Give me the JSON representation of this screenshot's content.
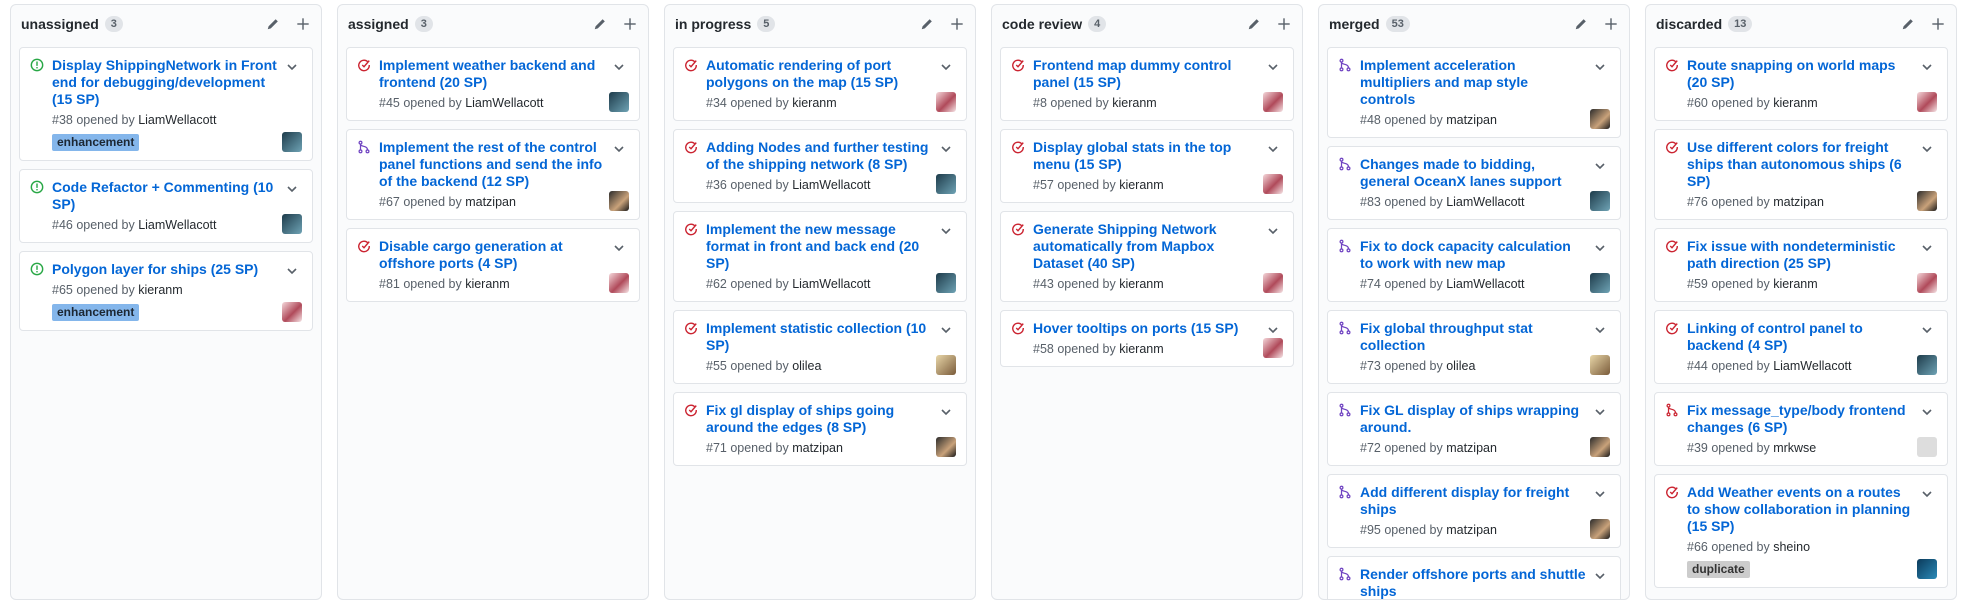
{
  "colors": {
    "open_issue": "#28a745",
    "closed_issue": "#cb2431",
    "merged_pr": "#6f42c1",
    "closed_pr": "#cb2431",
    "link": "#0366d6",
    "label_enhancement": "#84b6eb",
    "label_duplicate": "#cccccc"
  },
  "columns": [
    {
      "title": "unassigned",
      "count": "3",
      "cards": [
        {
          "title": "Display ShippingNetwork in Front end for debugging/development (15 SP)",
          "meta": "#38 opened by",
          "author": "LiamWellacott",
          "state": "open-issue",
          "label": "enhancement"
        },
        {
          "title": "Code Refactor + Commenting (10 SP)",
          "meta": "#46 opened by",
          "author": "LiamWellacott",
          "state": "open-issue"
        },
        {
          "title": "Polygon layer for ships (25 SP)",
          "meta": "#65 opened by",
          "author": "kieranm",
          "state": "open-issue",
          "label": "enhancement"
        }
      ]
    },
    {
      "title": "assigned",
      "count": "3",
      "cards": [
        {
          "title": "Implement weather backend and frontend (20 SP)",
          "meta": "#45 opened by",
          "author": "LiamWellacott",
          "state": "closed-issue"
        },
        {
          "title": "Implement the rest of the control panel functions and send the info of the backend (12 SP)",
          "meta": "#67 opened by",
          "author": "matzipan",
          "state": "merged-pr"
        },
        {
          "title": "Disable cargo generation at offshore ports (4 SP)",
          "meta": "#81 opened by",
          "author": "kieranm",
          "state": "closed-issue"
        }
      ]
    },
    {
      "title": "in progress",
      "count": "5",
      "cards": [
        {
          "title": "Automatic rendering of port polygons on the map (15 SP)",
          "meta": "#34 opened by",
          "author": "kieranm",
          "state": "closed-issue"
        },
        {
          "title": "Adding Nodes and further testing of the shipping network (8 SP)",
          "meta": "#36 opened by",
          "author": "LiamWellacott",
          "state": "closed-issue"
        },
        {
          "title": "Implement the new message format in front and back end (20 SP)",
          "meta": "#62 opened by",
          "author": "LiamWellacott",
          "state": "closed-issue"
        },
        {
          "title": "Implement statistic collection (10 SP)",
          "meta": "#55 opened by",
          "author": "olilea",
          "state": "closed-issue"
        },
        {
          "title": "Fix gl display of ships going around the edges (8 SP)",
          "meta": "#71 opened by",
          "author": "matzipan",
          "state": "closed-issue"
        }
      ]
    },
    {
      "title": "code review",
      "count": "4",
      "cards": [
        {
          "title": "Frontend map dummy control panel (15 SP)",
          "meta": "#8 opened by",
          "author": "kieranm",
          "state": "closed-issue"
        },
        {
          "title": "Display global stats in the top menu (15 SP)",
          "meta": "#57 opened by",
          "author": "kieranm",
          "state": "closed-issue"
        },
        {
          "title": "Generate Shipping Network automatically from Mapbox Dataset (40 SP)",
          "meta": "#43 opened by",
          "author": "kieranm",
          "state": "closed-issue"
        },
        {
          "title": "Hover tooltips on ports (15 SP)",
          "meta": "#58 opened by",
          "author": "kieranm",
          "state": "closed-issue"
        }
      ]
    },
    {
      "title": "merged",
      "count": "53",
      "cards": [
        {
          "title": "Implement acceleration multipliers and map style controls",
          "meta": "#48 opened by",
          "author": "matzipan",
          "state": "merged-pr"
        },
        {
          "title": "Changes made to bidding, general OceanX lanes support",
          "meta": "#83 opened by",
          "author": "LiamWellacott",
          "state": "merged-pr"
        },
        {
          "title": "Fix to dock capacity calculation to work with new map",
          "meta": "#74 opened by",
          "author": "LiamWellacott",
          "state": "merged-pr"
        },
        {
          "title": "Fix global throughput stat collection",
          "meta": "#73 opened by",
          "author": "olilea",
          "state": "merged-pr"
        },
        {
          "title": "Fix GL display of ships wrapping around.",
          "meta": "#72 opened by",
          "author": "matzipan",
          "state": "merged-pr"
        },
        {
          "title": "Add different display for freight ships",
          "meta": "#95 opened by",
          "author": "matzipan",
          "state": "merged-pr"
        },
        {
          "title": "Render offshore ports and shuttle ships",
          "meta": "",
          "author": "",
          "state": "merged-pr"
        }
      ]
    },
    {
      "title": "discarded",
      "count": "13",
      "cards": [
        {
          "title": "Route snapping on world maps (20 SP)",
          "meta": "#60 opened by",
          "author": "kieranm",
          "state": "closed-issue"
        },
        {
          "title": "Use different colors for freight ships than autonomous ships (6 SP)",
          "meta": "#76 opened by",
          "author": "matzipan",
          "state": "closed-issue"
        },
        {
          "title": "Fix issue with nondeterministic path direction (25 SP)",
          "meta": "#59 opened by",
          "author": "kieranm",
          "state": "closed-issue"
        },
        {
          "title": "Linking of control panel to backend (4 SP)",
          "meta": "#44 opened by",
          "author": "LiamWellacott",
          "state": "closed-issue"
        },
        {
          "title": "Fix message_type/body frontend changes (6 SP)",
          "meta": "#39 opened by",
          "author": "mrkwse",
          "state": "closed-pr"
        },
        {
          "title": "Add Weather events on a routes to show collaboration in planning (15 SP)",
          "meta": "#66 opened by",
          "author": "sheino",
          "state": "closed-issue",
          "label": "duplicate"
        }
      ]
    }
  ]
}
